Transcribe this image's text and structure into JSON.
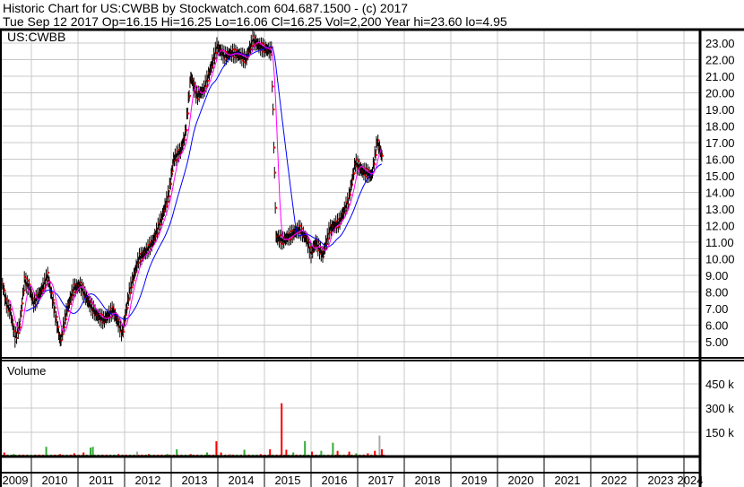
{
  "header": {
    "title": "Historic Chart for US:CWBB by Stockwatch.com 604.687.1500 - (c) 2017",
    "quote": "Tue Sep 12 2017  Op=16.15  Hi=16.25  Lo=16.06  Cl=16.25  Vol=2,200  Year hi=23.60  lo=4.95"
  },
  "chart_data": {
    "type": "line",
    "symbol": "US:CWBB",
    "volume_label": "Volume",
    "price_ticks": [
      "5.00",
      "6.00",
      "7.00",
      "8.00",
      "9.00",
      "10.00",
      "11.00",
      "12.00",
      "13.00",
      "14.00",
      "15.00",
      "16.00",
      "17.00",
      "18.00",
      "19.00",
      "20.00",
      "21.00",
      "22.00",
      "23.00"
    ],
    "price_ylim": [
      4,
      23.8
    ],
    "volume_ticks": [
      "150 k",
      "300 k",
      "450 k"
    ],
    "volume_tick_values": [
      150,
      300,
      450
    ],
    "volume_ylim_k": [
      0,
      600
    ],
    "years": [
      "2009",
      "2010",
      "2011",
      "2012",
      "2013",
      "2014",
      "2015",
      "2016",
      "2017",
      "2018",
      "2019",
      "2020",
      "2021",
      "2022",
      "2023",
      "2024"
    ],
    "xlim": [
      2009.33,
      2024.4
    ],
    "colors": {
      "price": "#ff0000",
      "bar": "#000000",
      "ma_short": "#ff00ff",
      "ma_long": "#0000ff",
      "vol_up": "#33aa33",
      "vol_down": "#ff0000",
      "vol_flat": "#aaaaaa",
      "grid": "#c8c8c8"
    },
    "price": [
      [
        2009.38,
        8.5
      ],
      [
        2009.45,
        7.4
      ],
      [
        2009.55,
        6.8
      ],
      [
        2009.65,
        5.2
      ],
      [
        2009.75,
        6.0
      ],
      [
        2009.85,
        8.7
      ],
      [
        2009.95,
        8.3
      ],
      [
        2010.05,
        7.3
      ],
      [
        2010.2,
        8.0
      ],
      [
        2010.35,
        9.0
      ],
      [
        2010.5,
        6.8
      ],
      [
        2010.62,
        5.0
      ],
      [
        2010.75,
        6.8
      ],
      [
        2010.9,
        8.2
      ],
      [
        2011.05,
        8.4
      ],
      [
        2011.2,
        7.5
      ],
      [
        2011.4,
        6.6
      ],
      [
        2011.55,
        6.3
      ],
      [
        2011.75,
        6.9
      ],
      [
        2011.95,
        5.5
      ],
      [
        2012.1,
        8.0
      ],
      [
        2012.3,
        10.0
      ],
      [
        2012.45,
        10.4
      ],
      [
        2012.6,
        11.0
      ],
      [
        2012.8,
        12.5
      ],
      [
        2012.95,
        14.0
      ],
      [
        2013.05,
        16.0
      ],
      [
        2013.2,
        16.5
      ],
      [
        2013.3,
        17.5
      ],
      [
        2013.42,
        21.0
      ],
      [
        2013.55,
        19.8
      ],
      [
        2013.7,
        20.2
      ],
      [
        2013.85,
        21.5
      ],
      [
        2013.98,
        22.8
      ],
      [
        2014.15,
        22.2
      ],
      [
        2014.3,
        22.4
      ],
      [
        2014.45,
        22.3
      ],
      [
        2014.6,
        22.0
      ],
      [
        2014.75,
        23.2
      ],
      [
        2014.9,
        22.8
      ],
      [
        2015.15,
        22.5
      ],
      [
        2015.25,
        11.3
      ],
      [
        2015.4,
        11.1
      ],
      [
        2015.55,
        11.4
      ],
      [
        2015.75,
        11.8
      ],
      [
        2015.9,
        11.2
      ],
      [
        2016.0,
        10.3
      ],
      [
        2016.1,
        11.0
      ],
      [
        2016.25,
        10.2
      ],
      [
        2016.4,
        11.8
      ],
      [
        2016.6,
        12.2
      ],
      [
        2016.8,
        13.5
      ],
      [
        2016.95,
        15.8
      ],
      [
        2017.1,
        15.3
      ],
      [
        2017.3,
        15.0
      ],
      [
        2017.42,
        17.1
      ],
      [
        2017.52,
        16.2
      ]
    ],
    "volume_k": [
      [
        2009.4,
        25,
        "down"
      ],
      [
        2009.6,
        15,
        "up"
      ],
      [
        2009.8,
        10,
        "down"
      ],
      [
        2010.15,
        10,
        "down"
      ],
      [
        2010.3,
        60,
        "up"
      ],
      [
        2010.6,
        15,
        "down"
      ],
      [
        2010.9,
        20,
        "down"
      ],
      [
        2011.1,
        25,
        "down"
      ],
      [
        2011.25,
        55,
        "up"
      ],
      [
        2011.3,
        60,
        "up"
      ],
      [
        2011.5,
        10,
        "down"
      ],
      [
        2011.85,
        15,
        "down"
      ],
      [
        2012.25,
        30,
        "flat"
      ],
      [
        2012.5,
        15,
        "down"
      ],
      [
        2012.9,
        15,
        "up"
      ],
      [
        2013.1,
        45,
        "up"
      ],
      [
        2013.4,
        15,
        "down"
      ],
      [
        2013.75,
        25,
        "up"
      ],
      [
        2013.95,
        95,
        "down"
      ],
      [
        2014.05,
        25,
        "down"
      ],
      [
        2014.25,
        15,
        "flat"
      ],
      [
        2014.55,
        42,
        "up"
      ],
      [
        2014.9,
        15,
        "down"
      ],
      [
        2015.1,
        45,
        "down"
      ],
      [
        2015.35,
        330,
        "down"
      ],
      [
        2015.45,
        42,
        "down"
      ],
      [
        2015.6,
        25,
        "up"
      ],
      [
        2015.85,
        95,
        "up"
      ],
      [
        2016.0,
        30,
        "down"
      ],
      [
        2016.2,
        35,
        "up"
      ],
      [
        2016.45,
        85,
        "up"
      ],
      [
        2016.55,
        35,
        "down"
      ],
      [
        2016.8,
        30,
        "down"
      ],
      [
        2016.95,
        20,
        "up"
      ],
      [
        2017.2,
        20,
        "down"
      ],
      [
        2017.35,
        35,
        "down"
      ],
      [
        2017.45,
        130,
        "flat"
      ],
      [
        2017.5,
        45,
        "down"
      ]
    ]
  }
}
